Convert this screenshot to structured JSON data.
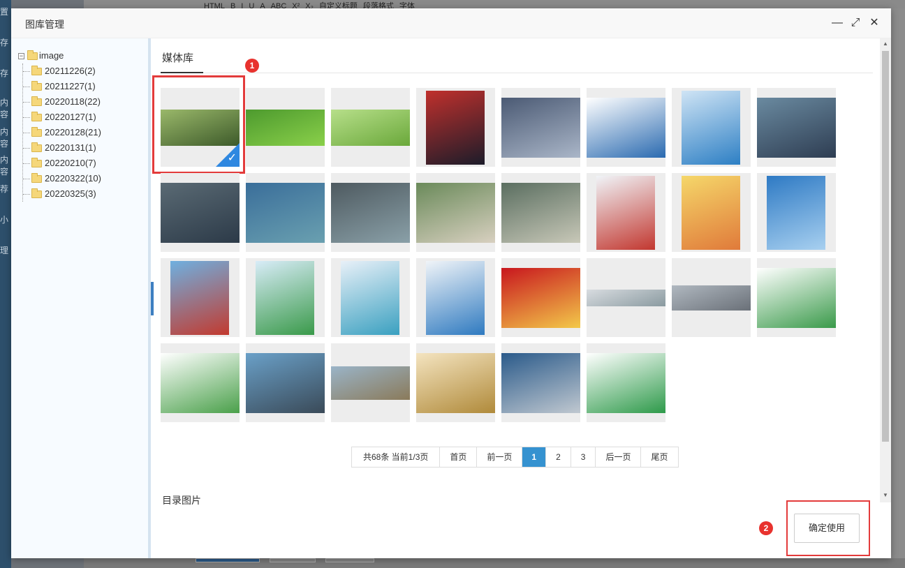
{
  "background": {
    "left_labels": [
      "置",
      "存",
      "存",
      "内容",
      "内容",
      "内容",
      "荐",
      "小",
      "理"
    ],
    "toolbar_items": [
      "HTML",
      "B",
      "I",
      "U",
      "A",
      "ABC",
      "X²",
      "X₂",
      "自定义标题",
      "段落格式",
      "字体"
    ]
  },
  "dialog": {
    "title": "图库管理",
    "controls": {
      "minimize": "—",
      "maximize": "⤢",
      "close": "✕"
    }
  },
  "tree": {
    "toggle": "−",
    "root": "image",
    "folders": [
      "20211226(2)",
      "20211227(1)",
      "20220118(22)",
      "20220127(1)",
      "20220128(21)",
      "20220131(1)",
      "20220210(7)",
      "20220322(10)",
      "20220325(3)"
    ]
  },
  "main": {
    "tab_label": "媒体库",
    "badge1": "1",
    "badge2": "2",
    "thumbs": [
      {
        "name": "green-leaf-dewdrop",
        "colors": [
          "#9ab86a",
          "#3d5a2a"
        ],
        "selected": true
      },
      {
        "name": "green-leaf",
        "colors": [
          "#4d9a2e",
          "#8ad04a"
        ]
      },
      {
        "name": "green-sprout",
        "colors": [
          "#b7df8a",
          "#6aa83a"
        ]
      },
      {
        "name": "speaker-podium",
        "colors": [
          "#c0302c",
          "#1c1c2a"
        ]
      },
      {
        "name": "conference-hall",
        "colors": [
          "#4b5a74",
          "#aab6c8"
        ]
      },
      {
        "name": "official-document",
        "colors": [
          "#ffffff",
          "#2a6ab0"
        ]
      },
      {
        "name": "safety-magazine-cover",
        "colors": [
          "#cfe4f5",
          "#2d7fc4"
        ]
      },
      {
        "name": "workers-helmets",
        "colors": [
          "#6a8aa0",
          "#2e3d52"
        ]
      },
      {
        "name": "inspection-team",
        "colors": [
          "#5a6a74",
          "#2c3a48"
        ]
      },
      {
        "name": "plant-inspection",
        "colors": [
          "#3a6e9a",
          "#6aa0b0"
        ]
      },
      {
        "name": "factory-visit",
        "colors": [
          "#4e5a60",
          "#8aa0a8"
        ]
      },
      {
        "name": "meeting-room",
        "colors": [
          "#6a8a5a",
          "#d8d0c0"
        ]
      },
      {
        "name": "meeting-hall",
        "colors": [
          "#5a6e60",
          "#c8c8b8"
        ]
      },
      {
        "name": "magazine-cover-plant",
        "colors": [
          "#f0f4f8",
          "#c2372f"
        ]
      },
      {
        "name": "magazine-cover-tree",
        "colors": [
          "#f5d76a",
          "#e07a3a"
        ]
      },
      {
        "name": "magazine-cover-city",
        "colors": [
          "#2e7ac4",
          "#a8d0f0"
        ]
      },
      {
        "name": "magazine-cover-firetruck",
        "colors": [
          "#6fb0e0",
          "#c23a2f"
        ]
      },
      {
        "name": "magazine-cover-magnifier",
        "colors": [
          "#d8ecf8",
          "#3a9a4a"
        ]
      },
      {
        "name": "magazine-cover-head",
        "colors": [
          "#e8f0f8",
          "#3aa0c0"
        ]
      },
      {
        "name": "magazine-cover-globe",
        "colors": [
          "#f0f4f8",
          "#2f7ac0"
        ]
      },
      {
        "name": "new-year-greeting",
        "colors": [
          "#c8161e",
          "#f3c94a"
        ]
      },
      {
        "name": "factory-panorama",
        "colors": [
          "#d8dce0",
          "#8a9aa0"
        ]
      },
      {
        "name": "factory-gate",
        "colors": [
          "#b0b8c0",
          "#6a7078"
        ]
      },
      {
        "name": "certificates-page",
        "colors": [
          "#ffffff",
          "#3a9a4a"
        ]
      },
      {
        "name": "certificates-list",
        "colors": [
          "#ffffff",
          "#4aa04a"
        ]
      },
      {
        "name": "plant-collage",
        "colors": [
          "#6aa0c8",
          "#3a4a58"
        ]
      },
      {
        "name": "plant-aerial",
        "colors": [
          "#9ab4c8",
          "#8a7a5a"
        ]
      },
      {
        "name": "award-plaques",
        "colors": [
          "#f4e4c0",
          "#b08a3a"
        ]
      },
      {
        "name": "activity-collage",
        "colors": [
          "#2a5a8a",
          "#c0c8d0"
        ]
      },
      {
        "name": "honor-wall",
        "colors": [
          "#ffffff",
          "#2e9a4a"
        ]
      }
    ],
    "pager": {
      "info": "共68条 当前1/3页",
      "first": "首页",
      "prev": "前一页",
      "pages": [
        "1",
        "2",
        "3"
      ],
      "next": "后一页",
      "last": "尾页"
    },
    "dir_title": "目录图片",
    "confirm": "确定使用"
  },
  "colors": {
    "accent": "#3592d0",
    "highlight": "#e33b3b",
    "check": "#2f88e0"
  }
}
